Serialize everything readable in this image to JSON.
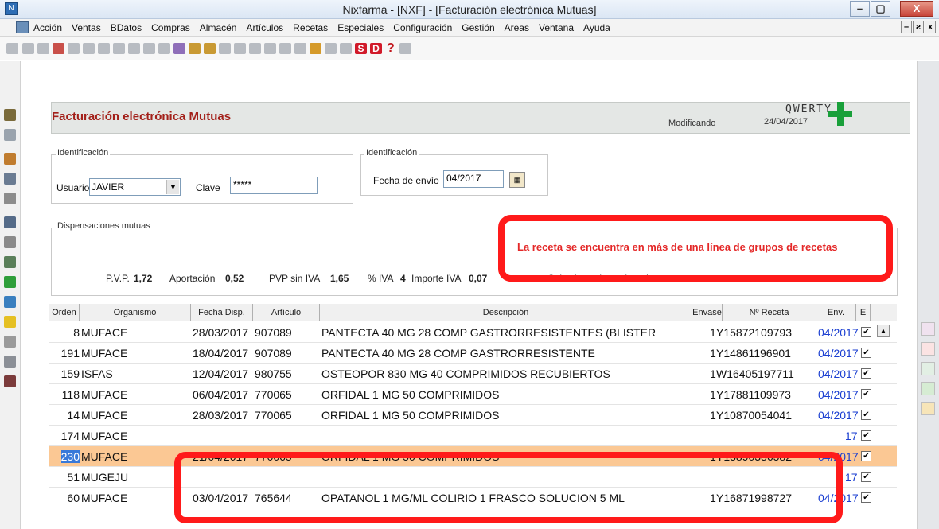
{
  "window": {
    "title": "Nixfarma - [NXF] - [Facturación electrónica Mutuas]",
    "min_label": "–",
    "max_label": "▢",
    "close_label": "X"
  },
  "menu": {
    "items": [
      "Acción",
      "Ventas",
      "BDatos",
      "Compras",
      "Almacén",
      "Artículos",
      "Recetas",
      "Especiales",
      "Configuración",
      "Gestión",
      "Areas",
      "Ventana",
      "Ayuda"
    ],
    "mdi_min": "–",
    "mdi_restore": "ƨ",
    "mdi_close": "x"
  },
  "toolbar": {
    "icons": [
      "exit-icon",
      "document-icon",
      "edit-icon",
      "lifebuoy-icon",
      "book-icon",
      "pencil-icon",
      "list-icon",
      "card-icon",
      "grid-icon",
      "report-icon",
      "star-icon",
      "forward-icon",
      "arrow-left-icon",
      "arrow-right-icon",
      "save-icon",
      "print-icon",
      "sync-icon",
      "tools-icon",
      "barcode-icon",
      "table-icon",
      "key-icon",
      "calculator-icon",
      "box-icon",
      "s-icon",
      "d-icon",
      "help-icon",
      "user-icon"
    ],
    "s_label": "S",
    "d_label": "D",
    "help_label": "?"
  },
  "form": {
    "title": "Facturación electrónica Mutuas",
    "company": "QWERTY",
    "status": "Modificando",
    "date": "24/04/2017",
    "ident_group_label": "Identificación",
    "user_label": "Usuario",
    "user_value": "JAVIER",
    "password_label": "Clave",
    "password_value": "*****",
    "send_group_label": "Identificación",
    "send_date_label": "Fecha de envío",
    "send_date_value": "04/2017",
    "dispens_group_label": "Dispensaciones mutuas",
    "alert": "La receta se encuentra en más de una línea de grupos de recetas"
  },
  "totals": {
    "pvp_label": "P.V.P.",
    "pvp_value": "1,72",
    "aportacion_label": "Aportación",
    "aportacion_value": "0,52",
    "pvp_sin_iva_label": "PVP sin IVA",
    "pvp_sin_iva_value": "1,65",
    "iva_pct_label": "% IVA",
    "iva_pct_value": "4",
    "importe_iva_label": "Importe IVA",
    "importe_iva_value": "0,07",
    "colectivo_label": "Colectivo subvencionado"
  },
  "table": {
    "columns": [
      "Orden",
      "Organismo",
      "Fecha Disp.",
      "Artículo",
      "Descripción",
      "Envase",
      "Nº Receta",
      "Env.",
      "E"
    ],
    "rows": [
      {
        "orden": "8",
        "organismo": "MUFACE",
        "fecha": "28/03/2017",
        "articulo": "907089",
        "descripcion": "PANTECTA 40 MG 28 COMP GASTRORRESISTENTES (BLISTER",
        "envase": "1",
        "receta": "Y15872109793",
        "env": "04/2017",
        "checked": true
      },
      {
        "orden": "191",
        "organismo": "MUFACE",
        "fecha": "18/04/2017",
        "articulo": "907089",
        "descripcion": "PANTECTA 40 MG 28 COMP GASTRORRESISTENTE",
        "envase": "1",
        "receta": "Y14861196901",
        "env": "04/2017",
        "checked": true
      },
      {
        "orden": "159",
        "organismo": "ISFAS",
        "fecha": "12/04/2017",
        "articulo": "980755",
        "descripcion": "OSTEOPOR 830 MG 40 COMPRIMIDOS RECUBIERTOS",
        "envase": "1",
        "receta": "W16405197711",
        "env": "04/2017",
        "checked": true
      },
      {
        "orden": "118",
        "organismo": "MUFACE",
        "fecha": "06/04/2017",
        "articulo": "770065",
        "descripcion": "ORFIDAL 1 MG 50 COMPRIMIDOS",
        "envase": "1",
        "receta": "Y17881109973",
        "env": "04/2017",
        "checked": true
      },
      {
        "orden": "14",
        "organismo": "MUFACE",
        "fecha": "28/03/2017",
        "articulo": "770065",
        "descripcion": "ORFIDAL 1 MG 50 COMPRIMIDOS",
        "envase": "1",
        "receta": "Y10870054041",
        "env": "04/2017",
        "checked": true
      },
      {
        "orden": "174",
        "organismo": "MUFACE",
        "fecha": "",
        "articulo": "",
        "descripcion": "",
        "envase": "",
        "receta": "",
        "env": "17",
        "checked": true
      },
      {
        "orden": "230",
        "organismo": "MUFACE",
        "fecha": "21/04/2017",
        "articulo": "770065",
        "descripcion": "ORFIDAL 1 MG 50 COMPRIMIDOS",
        "envase": "1",
        "receta": "Y13890336582",
        "env": "04/2017",
        "checked": true
      },
      {
        "orden": "51",
        "organismo": "MUGEJU",
        "fecha": "",
        "articulo": "",
        "descripcion": "",
        "envase": "",
        "receta": "",
        "env": "17",
        "checked": true
      },
      {
        "orden": "60",
        "organismo": "MUFACE",
        "fecha": "03/04/2017",
        "articulo": "765644",
        "descripcion": "OPATANOL 1 MG/ML COLIRIO 1 FRASCO SOLUCION 5 ML",
        "envase": "1",
        "receta": "Y16871998727",
        "env": "04/2017",
        "checked": true
      }
    ]
  },
  "colors": {
    "accent_red": "#e42828",
    "selected_row": "#fbc894",
    "link_blue": "#1a3ed1",
    "title_red": "#a3201a",
    "cross_green": "#19a03a"
  }
}
